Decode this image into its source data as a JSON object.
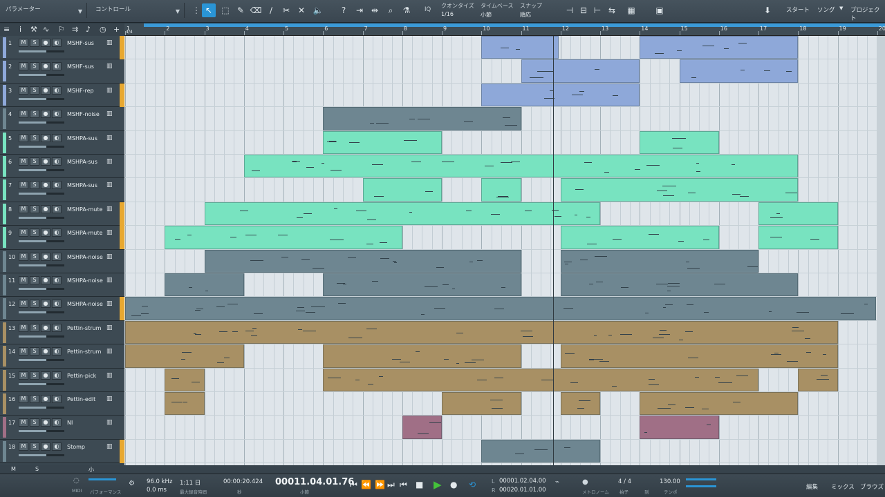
{
  "colors": {
    "blue": "#8ea8d9",
    "mint": "#78e3c0",
    "slate": "#6e8691",
    "tan": "#a89064",
    "mauve": "#a06f86",
    "record": "#e8a830",
    "accent": "#2a95d6"
  },
  "topbar": {
    "param_label": "パラメーター",
    "control_label": "コントロール",
    "quantize_label": "クオンタイズ",
    "quantize_value": "1/16",
    "timebase_label": "タイムベース",
    "timebase_value": "小節",
    "snap_label": "スナップ",
    "snap_value": "順応",
    "iq_label": "IQ",
    "start_label": "スタート",
    "song_label": "ソング",
    "project_label": "プロジェクト"
  },
  "ruler": {
    "bars": [
      "1",
      "2",
      "3",
      "4",
      "5",
      "6",
      "7",
      "8",
      "9",
      "10",
      "11",
      "12",
      "13",
      "14",
      "15",
      "16",
      "17",
      "18",
      "19",
      "20"
    ],
    "signature": "4/4"
  },
  "tracks": [
    {
      "num": "1",
      "name": "MSHF-sus",
      "color": "#8ea8d9",
      "rec": true,
      "fader": 0.6
    },
    {
      "num": "2",
      "name": "MSHF-sus",
      "color": "#8ea8d9",
      "rec": false,
      "fader": 0.6
    },
    {
      "num": "3",
      "name": "MSHF-rep",
      "color": "#8ea8d9",
      "rec": true,
      "fader": 0.6
    },
    {
      "num": "4",
      "name": "MSHF-noise",
      "color": "#6e8691",
      "rec": false,
      "fader": 0.6
    },
    {
      "num": "5",
      "name": "MSHPA-sus",
      "color": "#78e3c0",
      "rec": false,
      "fader": 0.6
    },
    {
      "num": "6",
      "name": "MSHPA-sus",
      "color": "#78e3c0",
      "rec": false,
      "fader": 0.6
    },
    {
      "num": "7",
      "name": "MSHPA-sus",
      "color": "#78e3c0",
      "rec": false,
      "fader": 0.6
    },
    {
      "num": "8",
      "name": "MSHPA-mute",
      "color": "#78e3c0",
      "rec": true,
      "fader": 0.6
    },
    {
      "num": "9",
      "name": "MSHPA-mute",
      "color": "#78e3c0",
      "rec": true,
      "fader": 0.6
    },
    {
      "num": "10",
      "name": "MSHPA-noise",
      "color": "#6e8691",
      "rec": false,
      "fader": 0.6
    },
    {
      "num": "11",
      "name": "MSHPA-noise",
      "color": "#6e8691",
      "rec": false,
      "fader": 0.6
    },
    {
      "num": "12",
      "name": "MSHPA-noise",
      "color": "#6e8691",
      "rec": true,
      "fader": 0.6
    },
    {
      "num": "13",
      "name": "Pettin-strum",
      "color": "#a89064",
      "rec": false,
      "fader": 0.6
    },
    {
      "num": "14",
      "name": "Pettin-strum",
      "color": "#a89064",
      "rec": false,
      "fader": 0.6
    },
    {
      "num": "15",
      "name": "Pettin-pick",
      "color": "#a89064",
      "rec": false,
      "fader": 0.6
    },
    {
      "num": "16",
      "name": "Pettin-edit",
      "color": "#a89064",
      "rec": false,
      "fader": 0.6
    },
    {
      "num": "17",
      "name": "NI",
      "color": "#a06f86",
      "rec": false,
      "fader": 0.6
    },
    {
      "num": "18",
      "name": "Stomp",
      "color": "#6e8691",
      "rec": true,
      "fader": 0.6
    }
  ],
  "clips": [
    {
      "t": 0,
      "s": 10,
      "e": 11.95,
      "c": "blue"
    },
    {
      "t": 0,
      "s": 14,
      "e": 18,
      "c": "blue"
    },
    {
      "t": 1,
      "s": 11,
      "e": 14,
      "c": "blue"
    },
    {
      "t": 1,
      "s": 15,
      "e": 18,
      "c": "blue"
    },
    {
      "t": 2,
      "s": 10,
      "e": 14,
      "c": "blue"
    },
    {
      "t": 3,
      "s": 6,
      "e": 11,
      "c": "slate"
    },
    {
      "t": 4,
      "s": 6,
      "e": 9,
      "c": "mint"
    },
    {
      "t": 4,
      "s": 14,
      "e": 16,
      "c": "mint"
    },
    {
      "t": 5,
      "s": 4,
      "e": 18,
      "c": "mint"
    },
    {
      "t": 6,
      "s": 7,
      "e": 9,
      "c": "mint"
    },
    {
      "t": 6,
      "s": 10,
      "e": 11,
      "c": "mint"
    },
    {
      "t": 6,
      "s": 12,
      "e": 18,
      "c": "mint"
    },
    {
      "t": 7,
      "s": 3,
      "e": 13,
      "c": "mint"
    },
    {
      "t": 7,
      "s": 17,
      "e": 19,
      "c": "mint"
    },
    {
      "t": 8,
      "s": 2,
      "e": 8,
      "c": "mint"
    },
    {
      "t": 8,
      "s": 12,
      "e": 16,
      "c": "mint"
    },
    {
      "t": 8,
      "s": 17,
      "e": 19,
      "c": "mint"
    },
    {
      "t": 9,
      "s": 3,
      "e": 11,
      "c": "slate"
    },
    {
      "t": 9,
      "s": 12,
      "e": 17,
      "c": "slate"
    },
    {
      "t": 10,
      "s": 2,
      "e": 4,
      "c": "slate"
    },
    {
      "t": 10,
      "s": 6,
      "e": 11,
      "c": "slate"
    },
    {
      "t": 10,
      "s": 12,
      "e": 18,
      "c": "slate"
    },
    {
      "t": 11,
      "s": 1,
      "e": 20,
      "c": "slate"
    },
    {
      "t": 12,
      "s": 1,
      "e": 19,
      "c": "tan"
    },
    {
      "t": 13,
      "s": 1,
      "e": 4,
      "c": "tan"
    },
    {
      "t": 13,
      "s": 6,
      "e": 11,
      "c": "tan"
    },
    {
      "t": 13,
      "s": 12,
      "e": 19,
      "c": "tan"
    },
    {
      "t": 14,
      "s": 2,
      "e": 3,
      "c": "tan"
    },
    {
      "t": 14,
      "s": 6,
      "e": 17,
      "c": "tan"
    },
    {
      "t": 14,
      "s": 18,
      "e": 19,
      "c": "tan"
    },
    {
      "t": 15,
      "s": 2,
      "e": 3,
      "c": "tan"
    },
    {
      "t": 15,
      "s": 9,
      "e": 11,
      "c": "tan"
    },
    {
      "t": 15,
      "s": 12,
      "e": 13,
      "c": "tan"
    },
    {
      "t": 15,
      "s": 14,
      "e": 18,
      "c": "tan"
    },
    {
      "t": 16,
      "s": 8,
      "e": 9,
      "c": "mauve"
    },
    {
      "t": 16,
      "s": 14,
      "e": 16,
      "c": "mauve"
    },
    {
      "t": 17,
      "s": 10,
      "e": 13,
      "c": "slate"
    }
  ],
  "hscroll": {
    "m": "M",
    "s": "S",
    "small": "小"
  },
  "transport": {
    "midi_label": "MIDI",
    "performance_label": "パフォーマンス",
    "sample_rate": "96.0 kHz",
    "latency": "0.0 ms",
    "rec_time": "1:11 日",
    "rec_time_label": "最大録音時間",
    "seconds": "00:00:20.424",
    "seconds_label": "秒",
    "bars": "00011.04.01.76",
    "bars_label": "小節",
    "loop_l": "00001.02.04.00",
    "loop_r": "00020.01.01.00",
    "l_label": "L",
    "r_label": "R",
    "metronome_label": "メトロノーム",
    "signature": "4 / 4",
    "signature_label": "拍子",
    "shift_label": "到",
    "tempo": "130.00",
    "tempo_label": "テンポ",
    "edit_label": "編集",
    "mix_label": "ミックス",
    "browse_label": "ブラウズ"
  }
}
